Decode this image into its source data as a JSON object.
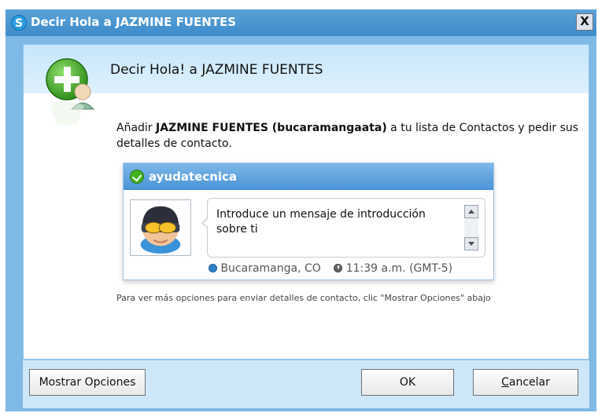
{
  "window": {
    "title": "Decir Hola a JAZMINE FUENTES",
    "title_icon": "skype-logo-icon",
    "close_label": "X"
  },
  "header": {
    "title": "Decir Hola! a JAZMINE FUENTES",
    "icon": "add-contact-icon"
  },
  "intro": {
    "prefix": "Añadir ",
    "contact_bold": "JAZMINE FUENTES (bucaramangaata)",
    "suffix": " a tu lista de Contactos y pedir sus detalles de contacto."
  },
  "card": {
    "username": "ayudatecnica",
    "status_icon": "online-status-icon",
    "avatar_icon": "avatar-icon",
    "message": "Introduce un mensaje de introducción sobre ti",
    "location": "Bucaramanga, CO",
    "time": "11:39 a.m. (GMT-5)"
  },
  "hint": "Para ver más opciones para enviar detalles de contacto, clic \"Mostrar Opciones\" abajo",
  "buttons": {
    "options": "Mostrar Opciones",
    "ok": "OK",
    "cancel_accel": "C",
    "cancel_rest": "ancelar"
  },
  "colors": {
    "title_bar": "#3d8bc9",
    "frame": "#7fb9e6",
    "header_band": "#c6e6fb",
    "card_header": "#4a93d6",
    "bottom_bar": "#cde7f8",
    "online_green": "#43b21f"
  }
}
